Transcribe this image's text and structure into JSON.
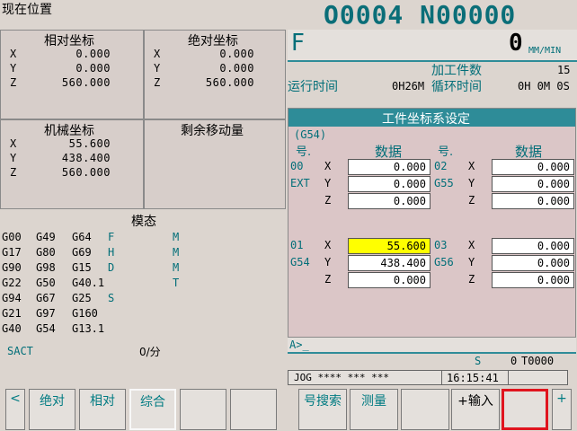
{
  "header": {
    "title": "现在位置",
    "program": "O0004 N00000"
  },
  "relative": {
    "title": "相对坐标",
    "axes": [
      {
        "axis": "X",
        "value": "0.000"
      },
      {
        "axis": "Y",
        "value": "0.000"
      },
      {
        "axis": "Z",
        "value": "560.000"
      }
    ]
  },
  "absolute": {
    "title": "绝对坐标",
    "axes": [
      {
        "axis": "X",
        "value": "0.000"
      },
      {
        "axis": "Y",
        "value": "0.000"
      },
      {
        "axis": "Z",
        "value": "560.000"
      }
    ]
  },
  "machine": {
    "title": "机械坐标",
    "axes": [
      {
        "axis": "X",
        "value": "55.600"
      },
      {
        "axis": "Y",
        "value": "438.400"
      },
      {
        "axis": "Z",
        "value": "560.000"
      }
    ]
  },
  "remaining": {
    "title": "剩余移动量"
  },
  "modal": {
    "title": "模态",
    "rows": [
      [
        "G00",
        "G49",
        "G64",
        "F",
        "M"
      ],
      [
        "G17",
        "G80",
        "G69",
        "H",
        "M"
      ],
      [
        "G90",
        "G98",
        "G15",
        "D",
        "M"
      ],
      [
        "G22",
        "G50",
        "G40.1",
        "",
        "T"
      ],
      [
        "G94",
        "G67",
        "G25",
        "S",
        ""
      ],
      [
        "G21",
        "G97",
        "G160",
        "",
        ""
      ],
      [
        "G40",
        "G54",
        "G13.1",
        "",
        ""
      ]
    ],
    "sact_label": "SACT",
    "sact_value": "0/分"
  },
  "status": {
    "feed_label": "F",
    "feed_value": "0",
    "feed_unit": "MM/MIN",
    "parts_label": "加工件数",
    "parts_value": "15",
    "run_label": "运行时间",
    "run_value": "0H26M",
    "cycle_label": "循环时间",
    "cycle_value": "0H 0M 0S"
  },
  "work_offset": {
    "title": "工件坐标系设定",
    "current": "(G54)",
    "col_no": "号.",
    "col_data": "数据",
    "groups": [
      {
        "no": "00",
        "code": "EXT",
        "axes": [
          {
            "axis": "X",
            "value": "0.000"
          },
          {
            "axis": "Y",
            "value": "0.000"
          },
          {
            "axis": "Z",
            "value": "0.000"
          }
        ]
      },
      {
        "no": "02",
        "code": "G55",
        "axes": [
          {
            "axis": "X",
            "value": "0.000"
          },
          {
            "axis": "Y",
            "value": "0.000"
          },
          {
            "axis": "Z",
            "value": "0.000"
          }
        ]
      },
      {
        "no": "01",
        "code": "G54",
        "axes": [
          {
            "axis": "X",
            "value": "55.600"
          },
          {
            "axis": "Y",
            "value": "438.400"
          },
          {
            "axis": "Z",
            "value": "0.000"
          }
        ]
      },
      {
        "no": "03",
        "code": "G56",
        "axes": [
          {
            "axis": "X",
            "value": "0.000"
          },
          {
            "axis": "Y",
            "value": "0.000"
          },
          {
            "axis": "Z",
            "value": "0.000"
          }
        ]
      }
    ]
  },
  "input_line": {
    "prompt": "A>_"
  },
  "spindle": {
    "label": "S",
    "value": "0",
    "tool": "T0000"
  },
  "mode": {
    "text": "JOG **** *** ***",
    "time": "16:15:41"
  },
  "softkeys_left": [
    "<",
    "绝对",
    "相对",
    "综合",
    "",
    ""
  ],
  "softkeys_right": [
    "号搜索",
    "测量",
    "",
    "+输入",
    "",
    "+"
  ],
  "colors": {
    "highlight": "#ffff00",
    "teal": "#006e78",
    "bar": "#2e8c98",
    "focus_border": "#e0141e"
  }
}
